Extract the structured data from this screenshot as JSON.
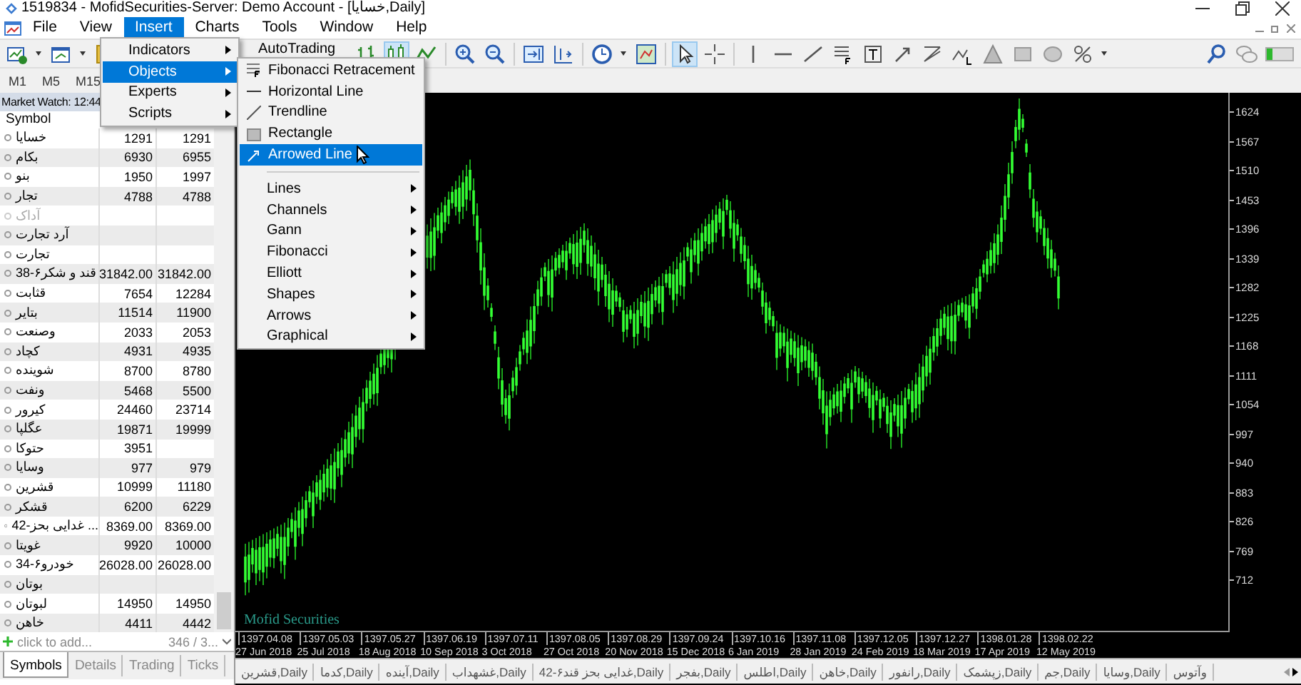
{
  "window": {
    "title": "1519834 - MofidSecurities-Server: Demo Account - [خسایا,Daily]"
  },
  "menu_bar": [
    {
      "label": "File",
      "selected": false
    },
    {
      "label": "View",
      "selected": false
    },
    {
      "label": "Insert",
      "selected": true
    },
    {
      "label": "Charts",
      "selected": false
    },
    {
      "label": "Tools",
      "selected": false
    },
    {
      "label": "Window",
      "selected": false
    },
    {
      "label": "Help",
      "selected": false
    }
  ],
  "toolbar": {
    "autotrading": "AutoTrading"
  },
  "timeframes": [
    "M1",
    "M5",
    "M15"
  ],
  "insert_menu": [
    {
      "label": "Indicators",
      "selected": false
    },
    {
      "label": "Objects",
      "selected": true
    },
    {
      "label": "Experts",
      "selected": false
    },
    {
      "label": "Scripts",
      "selected": false
    }
  ],
  "objects_submenu": {
    "tools": [
      {
        "label": "Fibonacci Retracement",
        "selected": false
      },
      {
        "label": "Horizontal Line",
        "selected": false
      },
      {
        "label": "Trendline",
        "selected": false
      },
      {
        "label": "Rectangle",
        "selected": false
      },
      {
        "label": "Arrowed Line",
        "selected": true
      }
    ],
    "groups": [
      "Lines",
      "Channels",
      "Gann",
      "Fibonacci",
      "Elliott",
      "Shapes",
      "Arrows",
      "Graphical"
    ]
  },
  "market_watch": {
    "title": "Market Watch: 12:44",
    "column": "Symbol",
    "rows": [
      {
        "symbol": "خسایا",
        "bid": "1291",
        "ask": "1291",
        "disabled": false
      },
      {
        "symbol": "بکام",
        "bid": "6930",
        "ask": "6955",
        "disabled": false
      },
      {
        "symbol": "بنو",
        "bid": "1950",
        "ask": "1997",
        "disabled": false
      },
      {
        "symbol": "تجار",
        "bid": "4788",
        "ask": "4788",
        "disabled": false
      },
      {
        "symbol": "آداک",
        "bid": "",
        "ask": "",
        "disabled": true
      },
      {
        "symbol": "آرد تجارت",
        "bid": "",
        "ask": "",
        "disabled": false
      },
      {
        "symbol": "تجارت",
        "bid": "",
        "ask": "",
        "disabled": false
      },
      {
        "symbol": "قند و شکر۶-38",
        "bid": "31842.00",
        "ask": "31842.00",
        "disabled": false
      },
      {
        "symbol": "قثابت",
        "bid": "7654",
        "ask": "12284",
        "disabled": false
      },
      {
        "symbol": "بتایر",
        "bid": "11514",
        "ask": "11900",
        "disabled": false
      },
      {
        "symbol": "وصنعت",
        "bid": "2033",
        "ask": "2053",
        "disabled": false
      },
      {
        "symbol": "کچاد",
        "bid": "4931",
        "ask": "4935",
        "disabled": false
      },
      {
        "symbol": "شوینده",
        "bid": "8700",
        "ask": "8780",
        "disabled": false
      },
      {
        "symbol": "ونفت",
        "bid": "5468",
        "ask": "5500",
        "disabled": false
      },
      {
        "symbol": "کیرور",
        "bid": "24460",
        "ask": "23714",
        "disabled": false
      },
      {
        "symbol": "عگلپا",
        "bid": "19871",
        "ask": "19999",
        "disabled": false
      },
      {
        "symbol": "حتوکا",
        "bid": "3951",
        "ask": "",
        "disabled": false
      },
      {
        "symbol": "وسایا",
        "bid": "977",
        "ask": "979",
        "disabled": false
      },
      {
        "symbol": "قشرین",
        "bid": "10999",
        "ask": "11180",
        "disabled": false
      },
      {
        "symbol": "قشکر",
        "bid": "6200",
        "ask": "6229",
        "disabled": false
      },
      {
        "symbol": "غدایی بحز-42 ...",
        "bid": "8369.00",
        "ask": "8369.00",
        "disabled": false
      },
      {
        "symbol": "غویتا",
        "bid": "9920",
        "ask": "10000",
        "disabled": false
      },
      {
        "symbol": "خودرو۶-34",
        "bid": "26028.00",
        "ask": "26028.00",
        "disabled": false
      },
      {
        "symbol": "بوتان",
        "bid": "",
        "ask": "",
        "disabled": false
      },
      {
        "symbol": "لبوتان",
        "bid": "14950",
        "ask": "14950",
        "disabled": false
      },
      {
        "symbol": "خاهن",
        "bid": "4411",
        "ask": "4442",
        "disabled": false
      }
    ],
    "add_hint": "click to add...",
    "count": "346 / 3...",
    "tabs": [
      {
        "label": "Symbols",
        "selected": true
      },
      {
        "label": "Details",
        "selected": false
      },
      {
        "label": "Trading",
        "selected": false
      },
      {
        "label": "Ticks",
        "selected": false
      }
    ]
  },
  "chart": {
    "watermark": "Mofid Securities",
    "price_labels": [
      "1624",
      "1567",
      "1510",
      "1453",
      "1396",
      "1339",
      "1282",
      "1225",
      "1168",
      "1111",
      "1054",
      "997",
      "940",
      "883",
      "826",
      "769",
      "712"
    ],
    "dates_upper": [
      "1397.04.08",
      "1397.05.03",
      "1397.05.27",
      "1397.06.19",
      "1397.07.11",
      "1397.08.05",
      "1397.08.29",
      "1397.09.24",
      "1397.10.16",
      "1397.11.08",
      "1397.12.05",
      "1397.12.27",
      "1398.01.28",
      "1398.02.22"
    ],
    "dates_lower": [
      "27 Jun 2018",
      "25 Jul 2018",
      "18 Aug 2018",
      "10 Sep 2018",
      "3 Oct 2018",
      "27 Oct 2018",
      "20 Nov 2018",
      "15 Dec 2018",
      "6 Jan 2019",
      "28 Jan 2019",
      "24 Feb 2019",
      "18 Mar 2019",
      "17 Apr 2019",
      "12 May 2019"
    ]
  },
  "chart_tabs": [
    "قشرین,Daily",
    "کدما,Daily",
    "آینده,Daily",
    "غشهداب,Daily",
    "غدایی بحز قند۶-42,Daily",
    "بفجر,Daily",
    "اطلس,Daily",
    "خاهن,Daily",
    "رانفور,Daily",
    "زپشمک,Daily",
    "جم,Daily",
    "وسایا,Daily",
    "وآتوس"
  ]
}
